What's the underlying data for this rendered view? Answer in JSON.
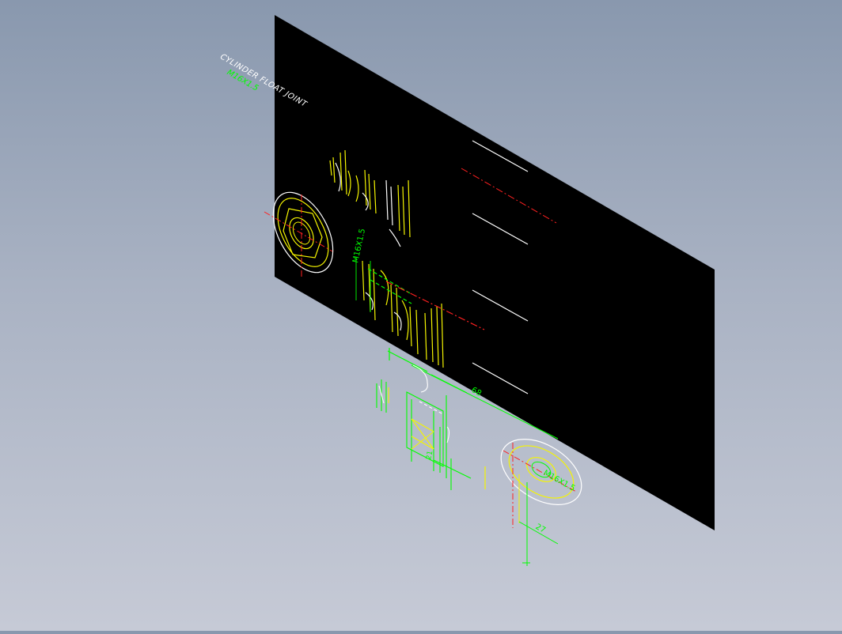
{
  "drawing": {
    "title_line1": "CYLINDER FLOAT JOINT",
    "title_line2": "M16X1.5",
    "dim_thread_vertical": "M16X1.5",
    "dim_thread_circle": "M16X1.5",
    "dim_length": "68",
    "dim_width": "27",
    "dim_small": "21"
  },
  "colors": {
    "sheet": "#000000",
    "geometry": "#f5f500",
    "outline": "#ffffff",
    "dimension": "#00ff00",
    "centerline": "#ff2020"
  }
}
